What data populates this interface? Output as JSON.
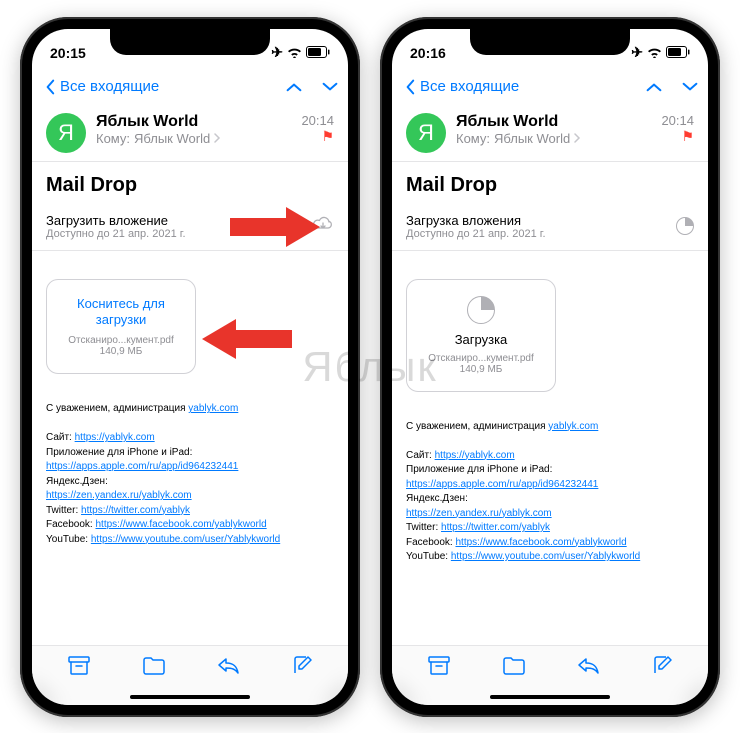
{
  "left": {
    "status_time": "20:15",
    "back_label": "Все входящие",
    "avatar_letter": "Я",
    "from_name": "Яблык World",
    "to_prefix": "Кому:",
    "to_name": "Яблык World",
    "msg_time": "20:14",
    "subject": "Mail Drop",
    "attach_title": "Загрузить вложение",
    "attach_sub": "Доступно до 21 апр. 2021 г.",
    "card_title_l1": "Коснитесь для",
    "card_title_l2": "загрузки",
    "card_fname": "Отсканиро...кумент.pdf",
    "card_size": "140,9 МБ"
  },
  "right": {
    "status_time": "20:16",
    "back_label": "Все входящие",
    "avatar_letter": "Я",
    "from_name": "Яблык World",
    "to_prefix": "Кому:",
    "to_name": "Яблык World",
    "msg_time": "20:14",
    "subject": "Mail Drop",
    "attach_title": "Загрузка вложения",
    "attach_sub": "Доступно до 21 апр. 2021 г.",
    "card_title": "Загрузка",
    "card_fname": "Отсканиро...кумент.pdf",
    "card_size": "140,9 МБ"
  },
  "sig": {
    "greeting_prefix": "С уважением, администрация ",
    "greeting_link": "yablyk.com",
    "site_label": "Сайт: ",
    "site_url": "https://yablyk.com",
    "app_label": "Приложение для iPhone и iPad:",
    "app_url": "https://apps.apple.com/ru/app/id964232441",
    "dzen_label": "Яндекс.Дзен:",
    "dzen_url": "https://zen.yandex.ru/yablyk.com",
    "tw_label": "Twitter: ",
    "tw_url": "https://twitter.com/yablyk",
    "fb_label": "Facebook: ",
    "fb_url": "https://www.facebook.com/yablykworld",
    "yt_label": "YouTube: ",
    "yt_url": "https://www.youtube.com/user/Yablykworld"
  },
  "watermark": "Яблык"
}
